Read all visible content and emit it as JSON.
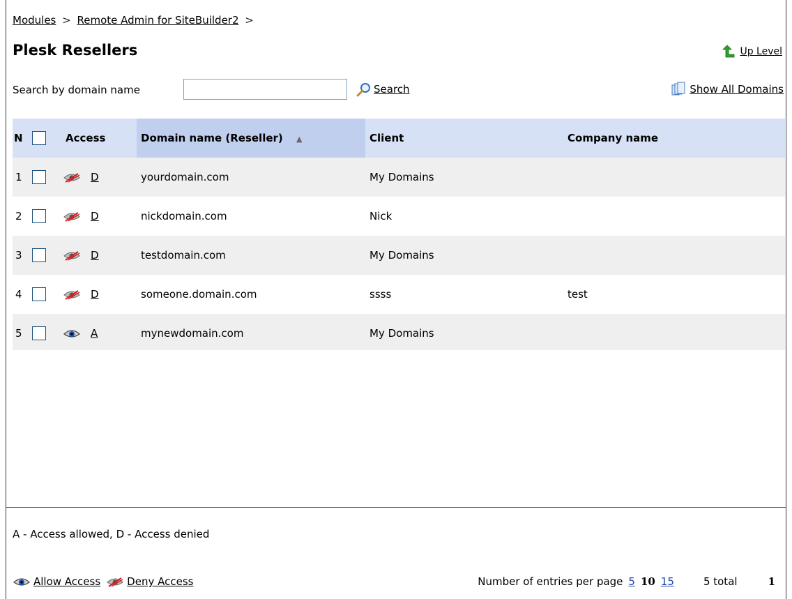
{
  "breadcrumb": {
    "items": [
      "Modules",
      "Remote Admin for SiteBuilder2"
    ],
    "separator": ">"
  },
  "page": {
    "title": "Plesk Resellers"
  },
  "up_level": {
    "label": "Up Level",
    "icon": "up-arrow-icon"
  },
  "search": {
    "label": "Search by domain name",
    "value": "",
    "placeholder": "",
    "button_label": "Search"
  },
  "show_all": {
    "label": "Show All Domains"
  },
  "table": {
    "columns": [
      "N",
      "",
      "Access",
      "Domain name (Reseller)",
      "Client",
      "Company name"
    ],
    "sort_indicator": "▲",
    "rows": [
      {
        "n": "1",
        "access": "D",
        "domain": "yourdomain.com",
        "client": "My Domains",
        "company": ""
      },
      {
        "n": "2",
        "access": "D",
        "domain": "nickdomain.com",
        "client": "Nick",
        "company": ""
      },
      {
        "n": "3",
        "access": "D",
        "domain": "testdomain.com",
        "client": "My Domains",
        "company": ""
      },
      {
        "n": "4",
        "access": "D",
        "domain": "someone.domain.com",
        "client": "ssss",
        "company": "test"
      },
      {
        "n": "5",
        "access": "A",
        "domain": "mynewdomain.com",
        "client": "My Domains",
        "company": ""
      }
    ]
  },
  "legend": {
    "text": "A - Access allowed, D - Access denied"
  },
  "actions": {
    "allow": "Allow Access",
    "deny": "Deny Access"
  },
  "pagination": {
    "label": "Number of entries per page",
    "options": [
      "5",
      "10",
      "15"
    ],
    "current": "10",
    "total": "5 total",
    "page": "1"
  },
  "colors": {
    "header_bg": "#d6e1f5",
    "sorted_header_bg": "#c0cfee",
    "odd_row": "#efefef",
    "link_blue": "#1f47a8"
  }
}
